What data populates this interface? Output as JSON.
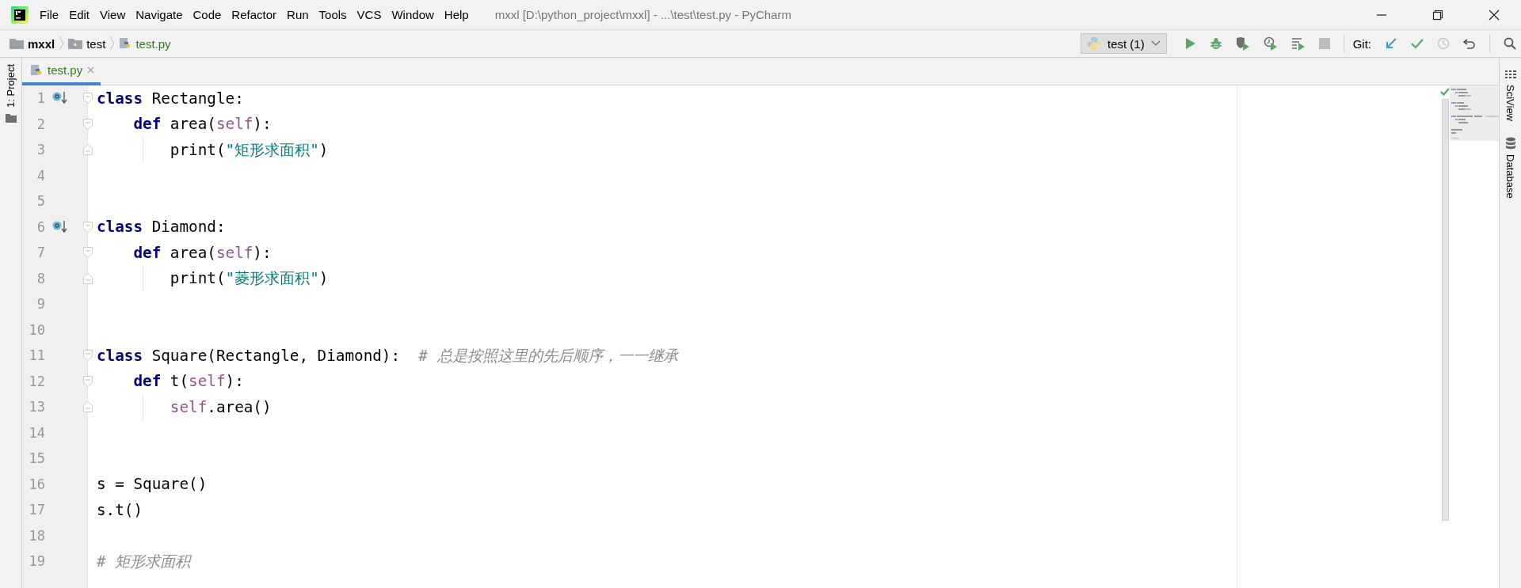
{
  "window": {
    "title": "mxxl [D:\\python_project\\mxxl] - ...\\test\\test.py - PyCharm",
    "menu": [
      "File",
      "Edit",
      "View",
      "Navigate",
      "Code",
      "Refactor",
      "Run",
      "Tools",
      "VCS",
      "Window",
      "Help"
    ]
  },
  "breadcrumb": [
    {
      "label": "mxxl",
      "kind": "project"
    },
    {
      "label": "test",
      "kind": "folder"
    },
    {
      "label": "test.py",
      "kind": "file"
    }
  ],
  "toolbar": {
    "run_config": "test (1)",
    "git_label": "Git:",
    "actions": [
      {
        "kind": "run",
        "disabled": false
      },
      {
        "kind": "debug",
        "disabled": false
      },
      {
        "kind": "coverage",
        "disabled": false
      },
      {
        "kind": "profile",
        "disabled": false
      },
      {
        "kind": "concurrency",
        "disabled": false
      },
      {
        "kind": "stop",
        "disabled": true
      }
    ],
    "git_actions": [
      {
        "kind": "update",
        "disabled": false
      },
      {
        "kind": "commit",
        "disabled": false
      },
      {
        "kind": "history",
        "disabled": true
      },
      {
        "kind": "rollback",
        "disabled": false
      }
    ]
  },
  "left_tool_strip": [
    {
      "label": "1: Project"
    }
  ],
  "right_tool_strip": [
    {
      "label": "SciView",
      "kind": "sciview"
    },
    {
      "label": "Database",
      "kind": "database"
    }
  ],
  "tabs": [
    {
      "label": "test.py",
      "selected": true
    }
  ],
  "editor": {
    "lines": [
      {
        "number": "1",
        "marker": true,
        "fold_open": true,
        "fold_close": false,
        "tokens": [
          {
            "kind": "keyword",
            "text": "class"
          },
          {
            "kind": "plain",
            "text": " Rectangle:"
          }
        ]
      },
      {
        "number": "2",
        "marker": false,
        "fold_open": true,
        "fold_close": false,
        "tokens": [
          {
            "kind": "keyword",
            "text": "    def"
          },
          {
            "kind": "plain",
            "text": " area("
          },
          {
            "kind": "self",
            "text": "self"
          },
          {
            "kind": "plain",
            "text": "):"
          }
        ]
      },
      {
        "number": "3",
        "marker": false,
        "fold_open": false,
        "fold_close": true,
        "tokens": [
          {
            "kind": "plain",
            "text": "        print("
          },
          {
            "kind": "string",
            "text": "\"矩形求面积\""
          },
          {
            "kind": "plain",
            "text": ")"
          }
        ]
      },
      {
        "number": "4",
        "marker": false,
        "fold_open": false,
        "fold_close": false
      },
      {
        "number": "5",
        "marker": false,
        "fold_open": false,
        "fold_close": false
      },
      {
        "number": "6",
        "marker": true,
        "fold_open": true,
        "fold_close": false,
        "tokens": [
          {
            "kind": "keyword",
            "text": "class"
          },
          {
            "kind": "plain",
            "text": " Diamond:"
          }
        ]
      },
      {
        "number": "7",
        "marker": false,
        "fold_open": true,
        "fold_close": false,
        "tokens": [
          {
            "kind": "keyword",
            "text": "    def"
          },
          {
            "kind": "plain",
            "text": " area("
          },
          {
            "kind": "self",
            "text": "self"
          },
          {
            "kind": "plain",
            "text": "):"
          }
        ]
      },
      {
        "number": "8",
        "marker": false,
        "fold_open": false,
        "fold_close": true,
        "tokens": [
          {
            "kind": "plain",
            "text": "        print("
          },
          {
            "kind": "string",
            "text": "\"菱形求面积\""
          },
          {
            "kind": "plain",
            "text": ")"
          }
        ]
      },
      {
        "number": "9",
        "marker": false,
        "fold_open": false,
        "fold_close": false
      },
      {
        "number": "10",
        "marker": false,
        "fold_open": false,
        "fold_close": false
      },
      {
        "number": "11",
        "marker": false,
        "fold_open": true,
        "fold_close": false,
        "tokens": [
          {
            "kind": "keyword",
            "text": "class"
          },
          {
            "kind": "plain",
            "text": " Square(Rectangle, Diamond):  "
          },
          {
            "kind": "comment",
            "text": "# 总是按照这里的先后顺序，一一继承"
          }
        ]
      },
      {
        "number": "12",
        "marker": false,
        "fold_open": true,
        "fold_close": false,
        "tokens": [
          {
            "kind": "keyword",
            "text": "    def"
          },
          {
            "kind": "plain",
            "text": " t("
          },
          {
            "kind": "self",
            "text": "self"
          },
          {
            "kind": "plain",
            "text": "):"
          }
        ]
      },
      {
        "number": "13",
        "marker": false,
        "fold_open": false,
        "fold_close": true,
        "tokens": [
          {
            "kind": "self",
            "text": "        self"
          },
          {
            "kind": "plain",
            "text": ".area()"
          }
        ]
      },
      {
        "number": "14",
        "marker": false,
        "fold_open": false,
        "fold_close": false
      },
      {
        "number": "15",
        "marker": false,
        "fold_open": false,
        "fold_close": false
      },
      {
        "number": "16",
        "marker": false,
        "fold_open": false,
        "fold_close": false,
        "tokens": [
          {
            "kind": "plain",
            "text": "s = Square()"
          }
        ]
      },
      {
        "number": "17",
        "marker": false,
        "fold_open": false,
        "fold_close": false,
        "tokens": [
          {
            "kind": "plain",
            "text": "s.t()"
          }
        ]
      },
      {
        "number": "18",
        "marker": false,
        "fold_open": false,
        "fold_close": false
      },
      {
        "number": "19",
        "marker": false,
        "fold_open": false,
        "fold_close": false,
        "tokens": [
          {
            "kind": "comment",
            "text": "# 矩形求面积"
          }
        ]
      }
    ]
  }
}
